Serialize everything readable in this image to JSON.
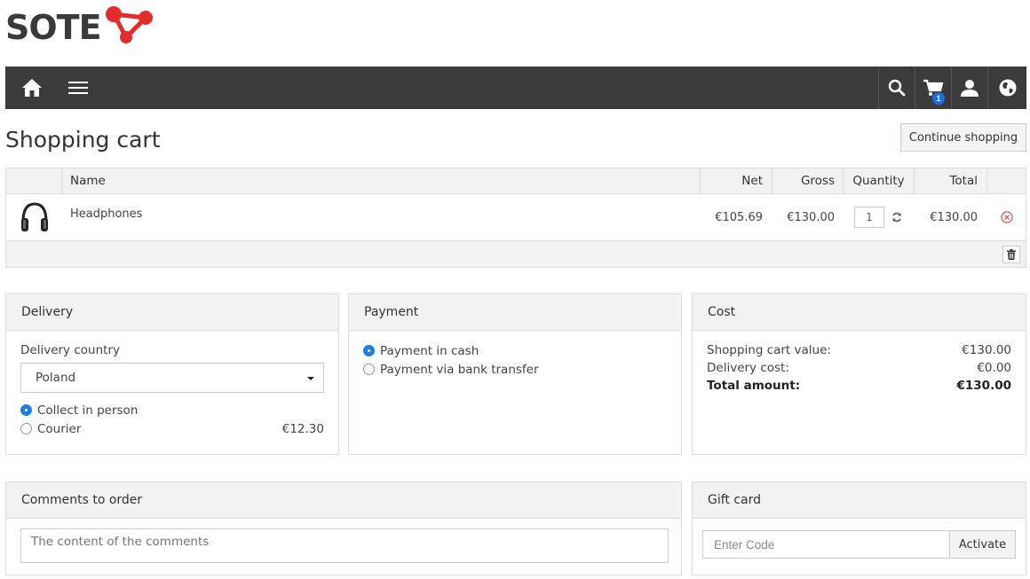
{
  "logo": {
    "text": "SOTE",
    "icon": "molecule-logo-icon",
    "accent": "#e32c2c"
  },
  "navbar": {
    "bg": "#3b3b3b",
    "left": [
      {
        "icon": "home-icon"
      },
      {
        "icon": "menu-icon"
      }
    ],
    "right": [
      {
        "icon": "search-icon"
      },
      {
        "icon": "cart-icon",
        "badge": "1"
      },
      {
        "icon": "user-icon"
      },
      {
        "icon": "globe-icon"
      }
    ]
  },
  "page": {
    "title": "Shopping cart",
    "continue_label": "Continue shopping"
  },
  "cart": {
    "columns": {
      "name": "Name",
      "net": "Net",
      "gross": "Gross",
      "quantity": "Quantity",
      "total": "Total"
    },
    "items": [
      {
        "name": "Headphones",
        "net": "€105.69",
        "gross": "€130.00",
        "quantity": "1",
        "total": "€130.00",
        "icon": "headphones-icon"
      }
    ]
  },
  "delivery": {
    "title": "Delivery",
    "country_label": "Delivery country",
    "country_value": "Poland",
    "options": [
      {
        "label": "Collect in person",
        "price": "",
        "selected": true
      },
      {
        "label": "Courier",
        "price": "€12.30",
        "selected": false
      }
    ]
  },
  "payment": {
    "title": "Payment",
    "options": [
      {
        "label": "Payment in cash",
        "selected": true
      },
      {
        "label": "Payment via bank transfer",
        "selected": false
      }
    ]
  },
  "cost": {
    "title": "Cost",
    "rows": [
      {
        "label": "Shopping cart value:",
        "value": "€130.00"
      },
      {
        "label": "Delivery cost:",
        "value": "€0.00"
      },
      {
        "label": "Total amount:",
        "value": "€130.00"
      }
    ]
  },
  "comments": {
    "title": "Comments to order",
    "placeholder": "The content of the comments"
  },
  "gift": {
    "title": "Gift card",
    "placeholder": "Enter Code",
    "button": "Activate"
  },
  "colors": {
    "radio_active": "#1d7ee5",
    "badge": "#1d6fe0",
    "remove": "#e04848"
  }
}
